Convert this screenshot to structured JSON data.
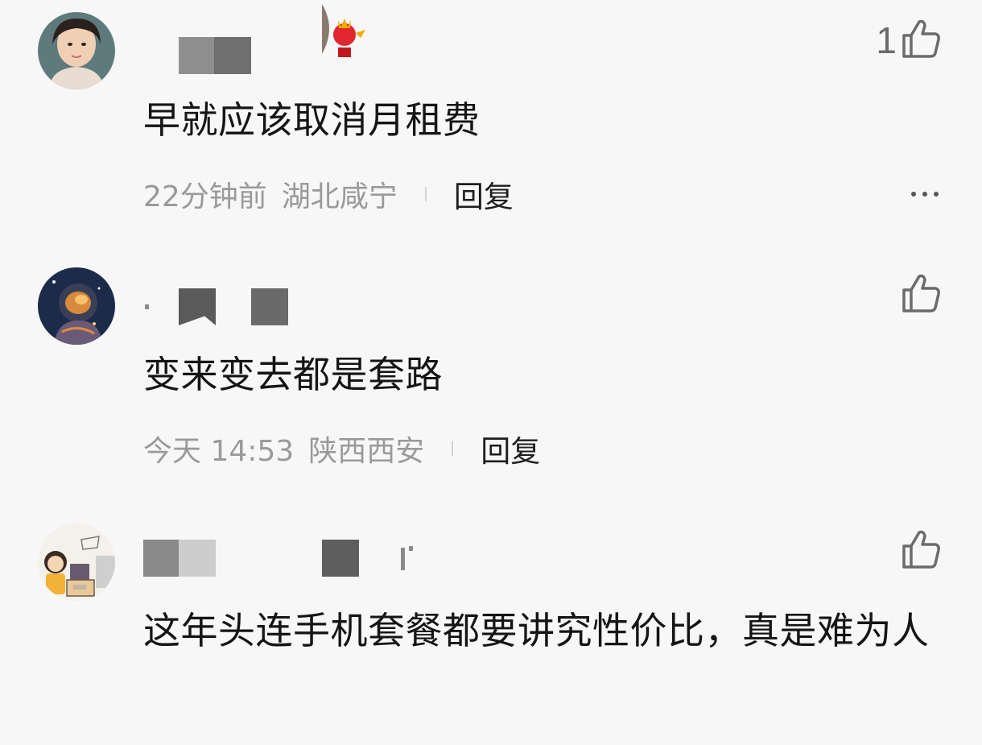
{
  "comments": [
    {
      "like_count": "1",
      "text": "早就应该取消月租费",
      "time": "22分钟前",
      "location": "湖北咸宁",
      "reply_label": "回复"
    },
    {
      "like_count": "",
      "text": "变来变去都是套路",
      "time": "今天 14:53",
      "location": "陕西西安",
      "reply_label": "回复"
    },
    {
      "like_count": "",
      "text": "这年头连手机套餐都要讲究性价比，真是难为人",
      "time": "",
      "location": "",
      "reply_label": ""
    }
  ],
  "colors": {
    "text_primary": "#151515",
    "text_secondary": "#9a9a9a",
    "background": "#f7f7f7"
  }
}
